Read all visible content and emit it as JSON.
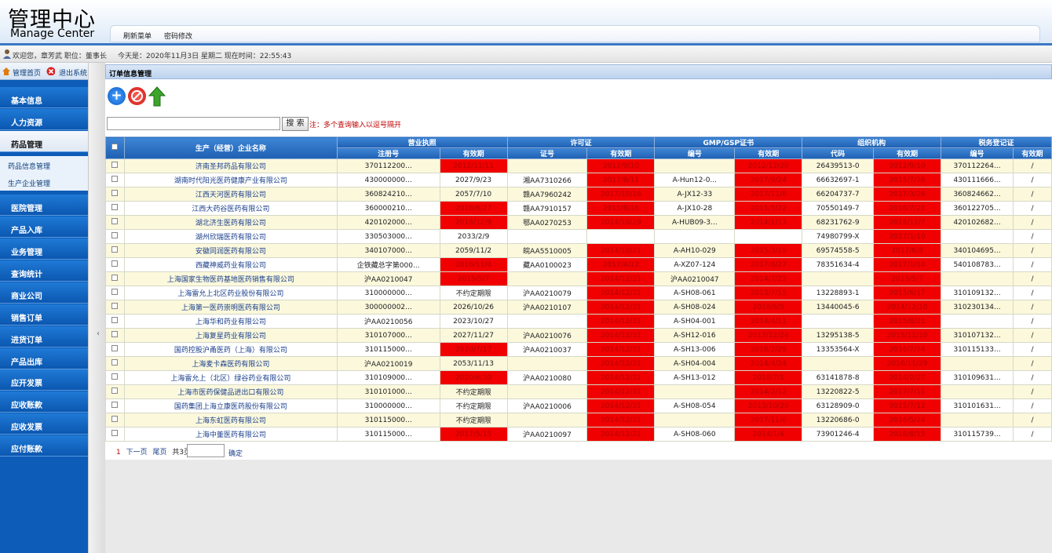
{
  "header": {
    "title_cn": "管理中心",
    "title_en": "Manage Center",
    "refresh_menu": "刷新菜单",
    "change_password": "密码修改"
  },
  "status": {
    "welcome": "欢迎您，章芳武 职位：董事长",
    "today": "今天是：2020年11月3日 星期二 现在时间：22:55:43"
  },
  "sidebar": {
    "home": "管理首页",
    "logout": "退出系统",
    "items": [
      {
        "label": "基本信息"
      },
      {
        "label": "人力资源"
      },
      {
        "label": "药品管理"
      },
      {
        "label": "医院管理"
      },
      {
        "label": "产品入库"
      },
      {
        "label": "业务管理"
      },
      {
        "label": "查询统计"
      },
      {
        "label": "商业公司"
      },
      {
        "label": "销售订单"
      },
      {
        "label": "进货订单"
      },
      {
        "label": "产品出库"
      },
      {
        "label": "应开发票"
      },
      {
        "label": "应收账款"
      },
      {
        "label": "应收发票"
      },
      {
        "label": "应付账款"
      }
    ],
    "subitems": [
      {
        "label": "药品信息管理"
      },
      {
        "label": "生产企业管理"
      }
    ]
  },
  "content": {
    "title": "订单信息管理",
    "search_button": "搜 索",
    "search_hint": "注：多个查询输入以逗号隔开",
    "search_value": ""
  },
  "table": {
    "group_headers": [
      "营业执照",
      "许可证",
      "GMP/GSP证书",
      "组织机构",
      "税务登记证"
    ],
    "name_header": "生产（经营）企业名称",
    "sub_headers": [
      "注册号",
      "有效期",
      "证号",
      "有效期",
      "编号",
      "有效期",
      "代码",
      "有效期",
      "编号",
      "有效期"
    ],
    "rows": [
      [
        "济南圣邦药品有限公司",
        "370112200...",
        "2012/11/11",
        "",
        "2012/9/10",
        "",
        "2012/12/28",
        "26439513-0",
        "2012/9/10",
        "370112264...",
        "/"
      ],
      [
        "湖南时代阳光医药健康产业有限公司",
        "430000000...",
        "2027/9/23",
        "湘AA7310266",
        "2017/8/11",
        "A-Hun12-0...",
        "2017/9/24",
        "66632697-1",
        "2015/7/26",
        "430111666...",
        "/"
      ],
      [
        "江西天河医药有限公司",
        "360824210...",
        "2057/7/10",
        "赣AA7960242",
        "2017/10/16",
        "A-JX12-33",
        "2017/11/6",
        "66204737-7",
        "2017/3/26",
        "360824662...",
        "/"
      ],
      [
        "江西大药谷医药有限公司",
        "360000210...",
        "2016/8/27",
        "赣AA7910157",
        "2015/8/16",
        "A-JX10-28",
        "2015/5/22",
        "70550149-7",
        "2016/7/21",
        "360122705...",
        "/"
      ],
      [
        "湖北济生医药有限公司",
        "420102000...",
        "2016/12/9",
        "鄂AA0270253",
        "2014/10/29",
        "A-HUB09-3...",
        "2014/1/13",
        "68231762-9",
        "2016/11/7",
        "420102682...",
        "/"
      ],
      [
        "湖州欣瑞医药有限公司",
        "330503000...",
        "2033/2/9",
        "",
        "",
        "",
        "",
        "74980799-X",
        "2017/1/10",
        "",
        "/"
      ],
      [
        "安徽同润医药有限公司",
        "340107000...",
        "2059/11/2",
        "皖AA5510005",
        "2014/10/21",
        "A-AH10-029",
        "2015/3/19",
        "69574558-5",
        "2017/6/8",
        "340104695...",
        "/"
      ],
      [
        "西藏神威药业有限公司",
        "企铁藏总字第000...",
        "2016/11/4",
        "藏AA0100023",
        "2017/4/12",
        "A-XZ07-124",
        "2017/8/27",
        "78351634-4",
        "2017/1/14",
        "540108783...",
        "/"
      ],
      [
        "上海国家生物医药基地医药销售有限公司",
        "沪AA0210047",
        "2015/5/7",
        "",
        "2014/12/31",
        "沪AA0210047",
        "2014/7/23",
        "",
        "2015/5/7",
        "",
        "/"
      ],
      [
        "上海雷允上北区药业股份有限公司",
        "310000000...",
        "不约定期限",
        "沪AA0210079",
        "2014/12/31",
        "A-SH08-061",
        "2013/7/15",
        "13228893-1",
        "2015/6/17",
        "310109132...",
        "/"
      ],
      [
        "上海第一医药崇明医药有限公司",
        "300000002...",
        "2026/10/26",
        "沪AA0210107",
        "2014/12/31",
        "A-SH08-024",
        "2018/6/5",
        "13440045-6",
        "2014/12/10",
        "310230134...",
        "/"
      ],
      [
        "上海华和药业有限公司",
        "沪AA0210056",
        "2023/10/27",
        "",
        "2014/12/31",
        "A-SH04-001",
        "2014/4/11",
        "",
        "2015/8/21",
        "",
        "/"
      ],
      [
        "上海复星药业有限公司",
        "310107000...",
        "2027/11/27",
        "沪AA0210076",
        "2014/12/31",
        "A-SH12-016",
        "2017/12/24",
        "13295138-5",
        "2015/11/10",
        "310107132...",
        "/"
      ],
      [
        "国药控股沪甬医药（上海）有限公司",
        "310115000...",
        "2020/7/17",
        "沪AA0210037",
        "2014/12/31",
        "A-SH13-006",
        "2018/2/29",
        "13353564-X",
        "2016/7/24",
        "310115133...",
        "/"
      ],
      [
        "上海麦卡森医药有限公司",
        "沪AA0210019",
        "2053/11/13",
        "",
        "2014/12/31",
        "A-SH04-004",
        "2014/4/24",
        "",
        "2016/11/29",
        "",
        "/"
      ],
      [
        "上海雷允上（北区）绿谷药业有限公司",
        "310109000...",
        "2020/6/30",
        "沪AA0210080",
        "2014/12/31",
        "A-SH13-012",
        "2018/7/1",
        "63141878-8",
        "2014/2/27",
        "310109631...",
        "/"
      ],
      [
        "上海市医药保健品进出口有限公司",
        "310101000...",
        "不约定期限",
        "",
        "2014/12/31",
        "",
        "2014/2/12",
        "13220822-5",
        "2017/7/11",
        "",
        "/"
      ],
      [
        "国药集团上海立康医药股份有限公司",
        "310000000...",
        "不约定期限",
        "沪AA0210006",
        "2014/12/31",
        "A-SH08-054",
        "2013/10/29",
        "63128909-0",
        "2015/7/12",
        "310101631...",
        "/"
      ],
      [
        "上海东虹医药有限公司",
        "310115000...",
        "不约定期限",
        "",
        "2014/12/31",
        "",
        "2017/11/6",
        "13220686-0",
        "2016/5/24",
        "",
        "/"
      ],
      [
        "上海中董医药有限公司",
        "310115000...",
        "2017/5/15",
        "沪AA0210097",
        "2014/12/31",
        "A-SH08-060",
        "2014/1/4",
        "73901246-4",
        "2016/8/15",
        "310115739...",
        "/"
      ]
    ],
    "red_cells": [
      [
        2,
        4,
        6,
        8
      ],
      [
        4,
        6,
        8
      ],
      [
        4,
        6,
        8
      ],
      [
        2,
        4,
        6,
        8
      ],
      [
        2,
        4,
        6,
        8
      ],
      [
        8
      ],
      [
        4,
        6,
        8
      ],
      [
        2,
        4,
        6,
        8
      ],
      [
        2,
        4,
        6,
        8
      ],
      [
        4,
        6,
        8
      ],
      [
        4,
        6,
        8
      ],
      [
        4,
        6,
        8
      ],
      [
        4,
        6,
        8
      ],
      [
        2,
        4,
        6,
        8
      ],
      [
        4,
        6,
        8
      ],
      [
        2,
        4,
        6,
        8
      ],
      [
        4,
        6,
        8
      ],
      [
        4,
        6,
        8
      ],
      [
        4,
        6,
        8
      ],
      [
        2,
        4,
        6,
        8
      ]
    ]
  },
  "pager": {
    "current": "1",
    "next": "下一页",
    "last": "尾页",
    "total": "共3页",
    "go": "确定"
  },
  "icons": {
    "add": "add-circle-icon",
    "delete": "forbidden-icon",
    "upload": "up-arrow-icon"
  }
}
